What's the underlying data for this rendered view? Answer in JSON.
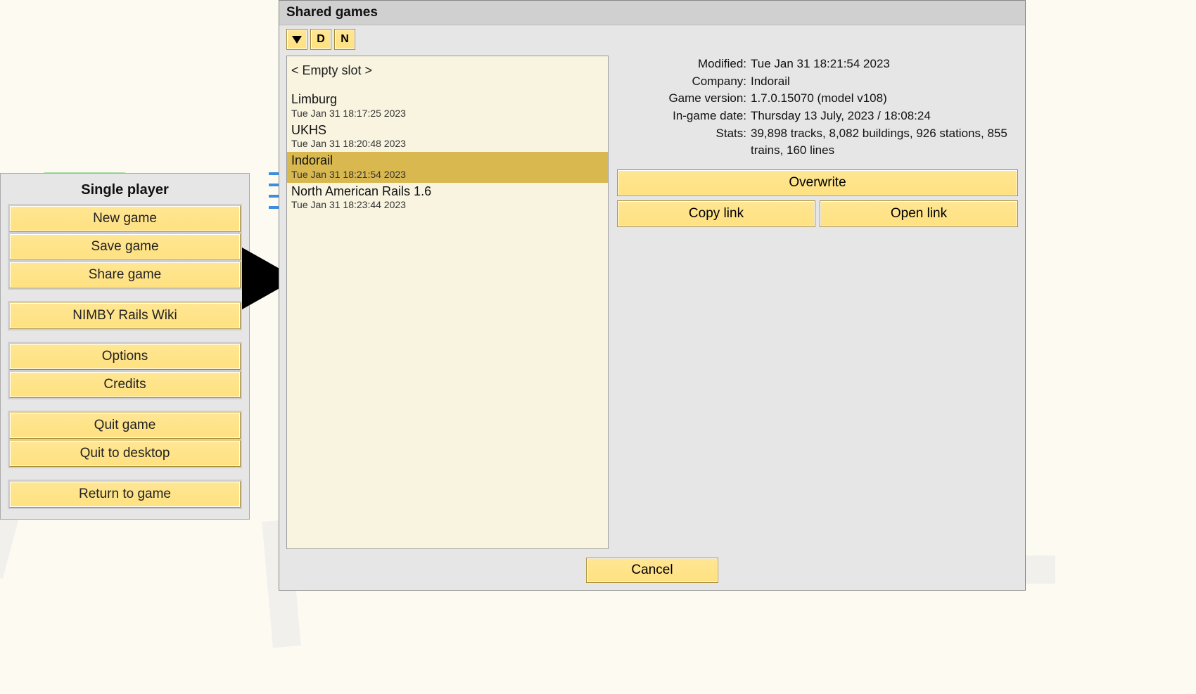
{
  "single_player": {
    "title": "Single player",
    "new_game": "New game",
    "save_game": "Save game",
    "share_game": "Share game",
    "wiki": "NIMBY Rails Wiki",
    "options": "Options",
    "credits": "Credits",
    "quit_game": "Quit game",
    "quit_desktop": "Quit to desktop",
    "return": "Return to game"
  },
  "shared": {
    "title": "Shared games",
    "toolbar": {
      "d": "D",
      "n": "N"
    },
    "empty_slot": "< Empty slot >",
    "slots": [
      {
        "name": "Limburg",
        "date": "Tue Jan 31 18:17:25 2023",
        "selected": false
      },
      {
        "name": "UKHS",
        "date": "Tue Jan 31 18:20:48 2023",
        "selected": false
      },
      {
        "name": "Indorail",
        "date": "Tue Jan 31 18:21:54 2023",
        "selected": true
      },
      {
        "name": "North American Rails 1.6",
        "date": "Tue Jan 31 18:23:44 2023",
        "selected": false
      }
    ],
    "detail": {
      "modified": {
        "label": "Modified:",
        "value": "Tue Jan 31 18:21:54 2023"
      },
      "company": {
        "label": "Company:",
        "value": "Indorail"
      },
      "version": {
        "label": "Game version:",
        "value": "1.7.0.15070 (model v108)"
      },
      "igdate": {
        "label": "In-game date:",
        "value": "Thursday 13 July, 2023 / 18:08:24"
      },
      "stats": {
        "label": "Stats:",
        "value": "39,898 tracks, 8,082 buildings, 926 stations, 855 trains, 160 lines"
      }
    },
    "actions": {
      "overwrite": "Overwrite",
      "copy": "Copy link",
      "open": "Open link",
      "cancel": "Cancel"
    }
  }
}
